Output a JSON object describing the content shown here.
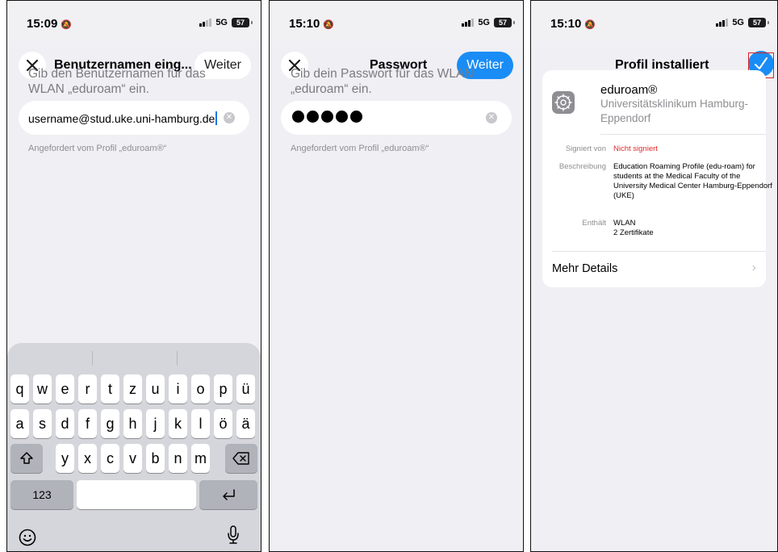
{
  "screens": [
    {
      "status": {
        "time": "15:09",
        "network": "5G",
        "battery": "57"
      },
      "nav": {
        "title": "Benutzernamen eing...",
        "weiter": "Weiter"
      },
      "prompt": "Gib den Benutzernamen für das WLAN „eduroam“ ein.",
      "field_value": "username@stud.uke.uni-hamburg.de",
      "hint": "Angefordert vom Profil „eduroam®“",
      "keyboard": {
        "row1": [
          "q",
          "w",
          "e",
          "r",
          "t",
          "z",
          "u",
          "i",
          "o",
          "p",
          "ü"
        ],
        "row2": [
          "a",
          "s",
          "d",
          "f",
          "g",
          "h",
          "j",
          "k",
          "l",
          "ö",
          "ä"
        ],
        "row3": [
          "y",
          "x",
          "c",
          "v",
          "b",
          "n",
          "m"
        ],
        "numbers_key": "123"
      }
    },
    {
      "status": {
        "time": "15:10",
        "network": "5G",
        "battery": "57"
      },
      "nav": {
        "title": "Passwort",
        "weiter": "Weiter"
      },
      "prompt": "Gib dein Passwort für das WLAN „eduroam“ ein.",
      "password_length": 5,
      "hint": "Angefordert vom Profil „eduroam®“"
    },
    {
      "status": {
        "time": "15:10",
        "network": "5G",
        "battery": "57"
      },
      "nav": {
        "title": "Profil installiert"
      },
      "profile": {
        "name": "eduroam®",
        "org": "Universitätsklinikum Hamburg-Eppendorf",
        "signed_label": "Signiert von",
        "signed_value": "Nicht signiert",
        "desc_label": "Beschreibung",
        "desc_value": "Education Roaming Profile (edu-roam) for students at the Medical Faculty of the University Medical Center Hamburg-Eppendorf (UKE)",
        "contains_label": "Enthält",
        "contains_value_1": "WLAN",
        "contains_value_2": "2 Zertifikate",
        "more_details": "Mehr Details"
      }
    }
  ]
}
